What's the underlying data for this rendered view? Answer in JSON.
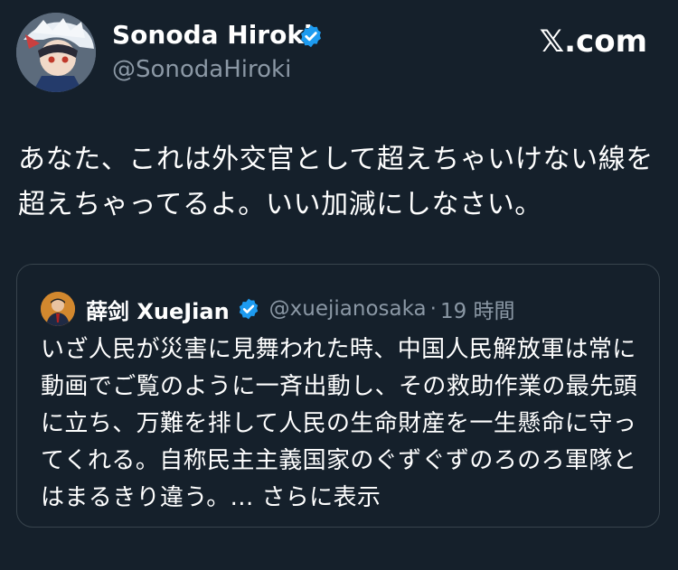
{
  "site": {
    "logo_text": "𝕏.com"
  },
  "author": {
    "name": "Sonoda Hiroki",
    "handle": "@SonodaHiroki",
    "verified_icon": "verified-badge-icon",
    "accent_color": "#1d9bf0"
  },
  "tweet": {
    "text": "あなた、これは外交官として超えちゃいけない線を超えちゃってるよ。いい加減にしなさい。"
  },
  "quoted": {
    "name": "薛剑 XueJian",
    "handle": "@xuejianosaka",
    "separator": "·",
    "time": "19 時間",
    "text": "いざ人民が災害に見舞われた時、中国人民解放軍は常に動画でご覧のように一斉出動し、その救助作業の最先頭に立ち、万難を排して人民の生命財産を一生懸命に守ってくれる。自称民主主義国家のぐずぐずのろのろ軍隊とはまるきり違う。... ",
    "show_more": "さらに表示"
  },
  "colors": {
    "background": "#15202b",
    "secondary_text": "#8b98a5",
    "border": "#38444d"
  }
}
